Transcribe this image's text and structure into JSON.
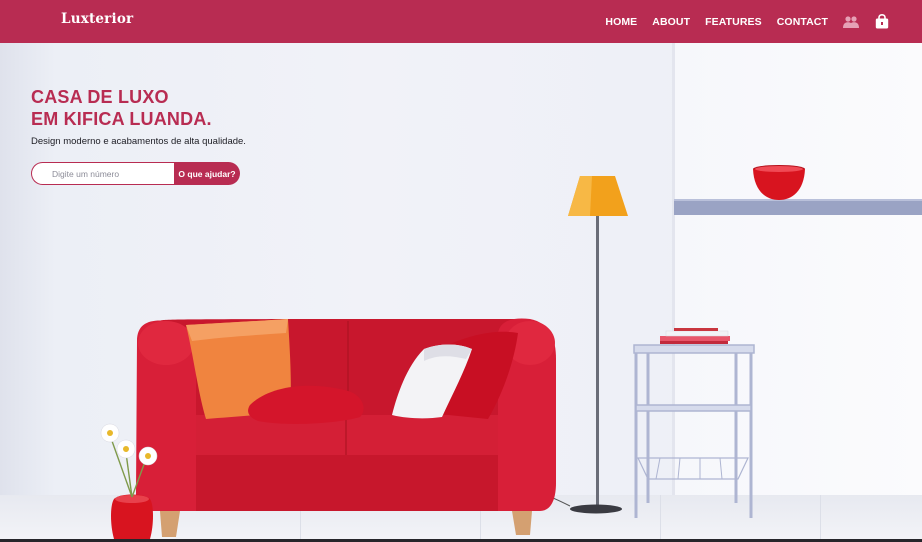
{
  "brand": {
    "name": "Luxterior"
  },
  "nav": {
    "links": [
      {
        "label": "HOME"
      },
      {
        "label": "ABOUT"
      },
      {
        "label": "FEATURES"
      },
      {
        "label": "CONTACT"
      }
    ],
    "icons": {
      "account": "users-icon",
      "cart": "shopping-bag-icon"
    }
  },
  "hero": {
    "title_line1": "CASA DE LUXO",
    "title_line2": "EM KIFICA LUANDA.",
    "subtitle": "Design moderno e acabamentos de alta qualidade.",
    "search": {
      "placeholder": "Digite um número",
      "value": "",
      "button_label": "O que ajudar?"
    }
  },
  "colors": {
    "brand": "#b82c52",
    "sofa": "#d41f36",
    "lamp_shade": "#f2a11c",
    "pillow_orange": "#f0843f",
    "bowl": "#d8141f"
  }
}
